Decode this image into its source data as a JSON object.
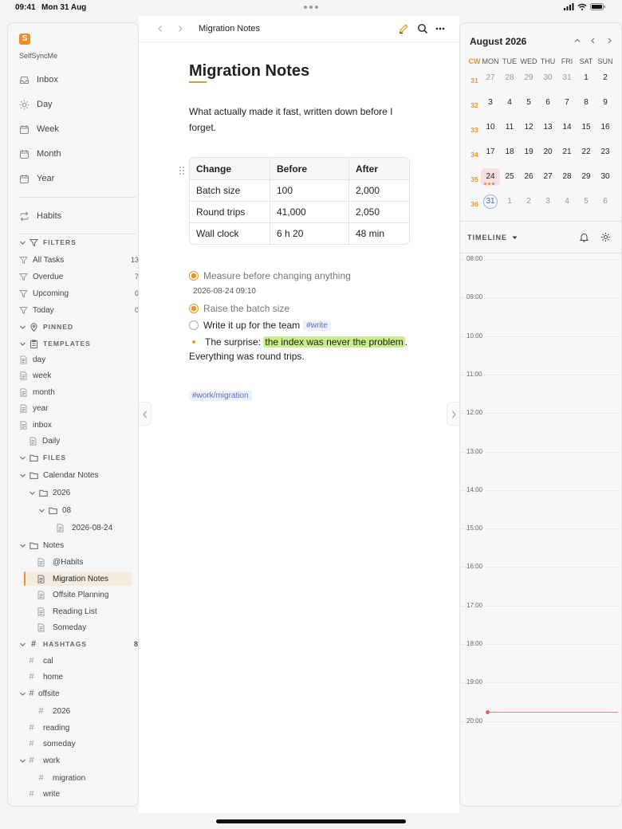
{
  "status": {
    "time": "09:41",
    "date": "Mon 31 Aug"
  },
  "sidebar": {
    "app_name": "SelfSyncMe",
    "nav": [
      {
        "label": "Inbox",
        "icon": "inbox-icon"
      },
      {
        "label": "Day",
        "icon": "sun-icon"
      },
      {
        "label": "Week",
        "icon": "calendar-icon"
      },
      {
        "label": "Month",
        "icon": "calendar-icon"
      },
      {
        "label": "Year",
        "icon": "calendar-icon"
      }
    ],
    "habits": "Habits",
    "filters": {
      "title": "FILTERS",
      "items": [
        {
          "label": "All Tasks",
          "count": "13"
        },
        {
          "label": "Overdue",
          "count": "7"
        },
        {
          "label": "Upcoming",
          "count": "0"
        },
        {
          "label": "Today",
          "count": "0"
        }
      ]
    },
    "pinned": "PINNED",
    "templates": {
      "title": "TEMPLATES",
      "items": [
        "day",
        "week",
        "month",
        "year",
        "inbox"
      ],
      "sub": "Daily"
    },
    "files": {
      "title": "FILES",
      "calendar_notes": "Calendar Notes",
      "year": "2026",
      "month": "08",
      "day_note": "2026-08-24",
      "notes": "Notes",
      "note_items": [
        "@Habits",
        "Migration Notes",
        "Offsite Planning",
        "Reading List",
        "Someday"
      ]
    },
    "hashtags": {
      "title": "HASHTAGS",
      "count": "8",
      "items": [
        "cal",
        "home",
        "offsite",
        "2026",
        "reading",
        "someday",
        "work",
        "migration",
        "write"
      ]
    }
  },
  "editor": {
    "title": "Migration Notes",
    "heading": "Migration Notes",
    "intro": "What actually made it fast, written down before I forget.",
    "table": {
      "headers": [
        "Change",
        "Before",
        "After"
      ],
      "rows": [
        [
          "Batch size",
          "100",
          "2,000"
        ],
        [
          "Round trips",
          "41,000",
          "2,050"
        ],
        [
          "Wall clock",
          "6 h 20",
          "48 min"
        ]
      ]
    },
    "task1": "Measure before changing anything",
    "timestamp": "2026-08-24 09:10",
    "task2": "Raise the batch size",
    "task3": "Write it up for the team",
    "task3_tag": "#write",
    "bullet_prefix": "The surprise:",
    "bullet_highlight": "the index was never the problem",
    "bullet_suffix": ".",
    "continuation": "Everything was round trips.",
    "tag": "#work/migration"
  },
  "calendar": {
    "title": "August 2026",
    "headers": [
      "CW",
      "MON",
      "TUE",
      "WED",
      "THU",
      "FRI",
      "SAT",
      "SUN"
    ],
    "weeks": [
      [
        "31",
        "27",
        "28",
        "29",
        "30",
        "31",
        "1",
        "2"
      ],
      [
        "32",
        "3",
        "4",
        "5",
        "6",
        "7",
        "8",
        "9"
      ],
      [
        "33",
        "10",
        "11",
        "12",
        "13",
        "14",
        "15",
        "16"
      ],
      [
        "34",
        "17",
        "18",
        "19",
        "20",
        "21",
        "22",
        "23"
      ],
      [
        "35",
        "24",
        "25",
        "26",
        "27",
        "28",
        "29",
        "30"
      ],
      [
        "36",
        "31",
        "1",
        "2",
        "3",
        "4",
        "5",
        "6"
      ]
    ],
    "selected": "24",
    "today": "31"
  },
  "timeline": {
    "label": "TIMELINE",
    "hours": [
      "08:00",
      "09:00",
      "10:00",
      "11:00",
      "12:00",
      "13:00",
      "14:00",
      "15:00",
      "16:00",
      "17:00",
      "18:00",
      "19:00",
      "20:00"
    ]
  },
  "colors": {
    "accent": "#e89628",
    "highlight": "#c8ee8a",
    "tag": "#5b6fbf",
    "now_line": "#e26060"
  }
}
